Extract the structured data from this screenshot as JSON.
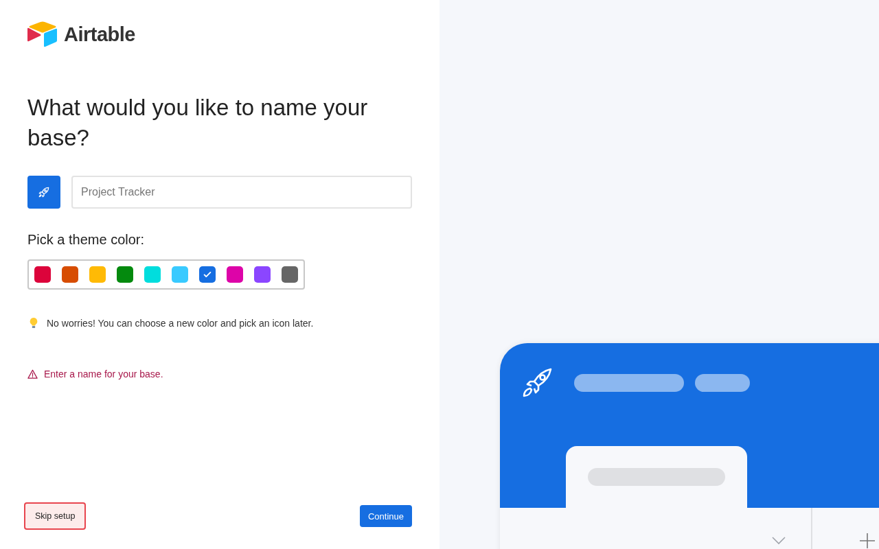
{
  "logo": {
    "wordmark": "Airtable"
  },
  "heading": "What would you like to name your base?",
  "name_field": {
    "placeholder": "Project Tracker"
  },
  "theme": {
    "label": "Pick a theme color:",
    "swatches": [
      {
        "color": "#dc043b",
        "selected": false
      },
      {
        "color": "#d74d02",
        "selected": false
      },
      {
        "color": "#ffba05",
        "selected": false
      },
      {
        "color": "#048a0e",
        "selected": false
      },
      {
        "color": "#01dddd",
        "selected": false
      },
      {
        "color": "#39caff",
        "selected": false
      },
      {
        "color": "#166ee1",
        "selected": true
      },
      {
        "color": "#dd04a8",
        "selected": false
      },
      {
        "color": "#8b46ff",
        "selected": false
      },
      {
        "color": "#666666",
        "selected": false
      }
    ]
  },
  "tip": "No worries! You can choose a new color and pick an icon later.",
  "error": "Enter a name for your base.",
  "buttons": {
    "skip": "Skip setup",
    "continue": "Continue"
  }
}
